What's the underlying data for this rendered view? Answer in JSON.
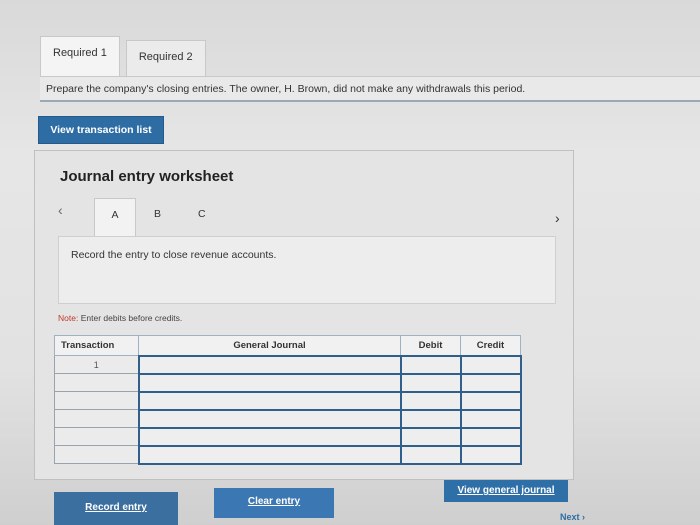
{
  "tabs": [
    {
      "label": "Required 1",
      "active": true
    },
    {
      "label": "Required 2",
      "active": false
    }
  ],
  "prompt": "Prepare the company's closing entries. The owner, H. Brown, did not make any withdrawals this period.",
  "view_transaction_list": "View transaction list",
  "worksheet": {
    "title": "Journal entry worksheet",
    "steps": [
      "A",
      "B",
      "C"
    ],
    "instruction": "Record the entry to close revenue accounts.",
    "note_label": "Note:",
    "note_text": "Enter debits before credits.",
    "columns": [
      "Transaction",
      "General Journal",
      "Debit",
      "Credit"
    ],
    "rows": [
      {
        "transaction": "1"
      },
      {
        "transaction": ""
      },
      {
        "transaction": ""
      },
      {
        "transaction": ""
      },
      {
        "transaction": ""
      },
      {
        "transaction": ""
      }
    ]
  },
  "buttons": {
    "record_entry": "Record entry",
    "clear_entry": "Clear entry",
    "view_general_journal": "View general journal",
    "next": "Next"
  },
  "colors": {
    "accent": "#2e6da4",
    "table_border": "#2f5f8a"
  }
}
